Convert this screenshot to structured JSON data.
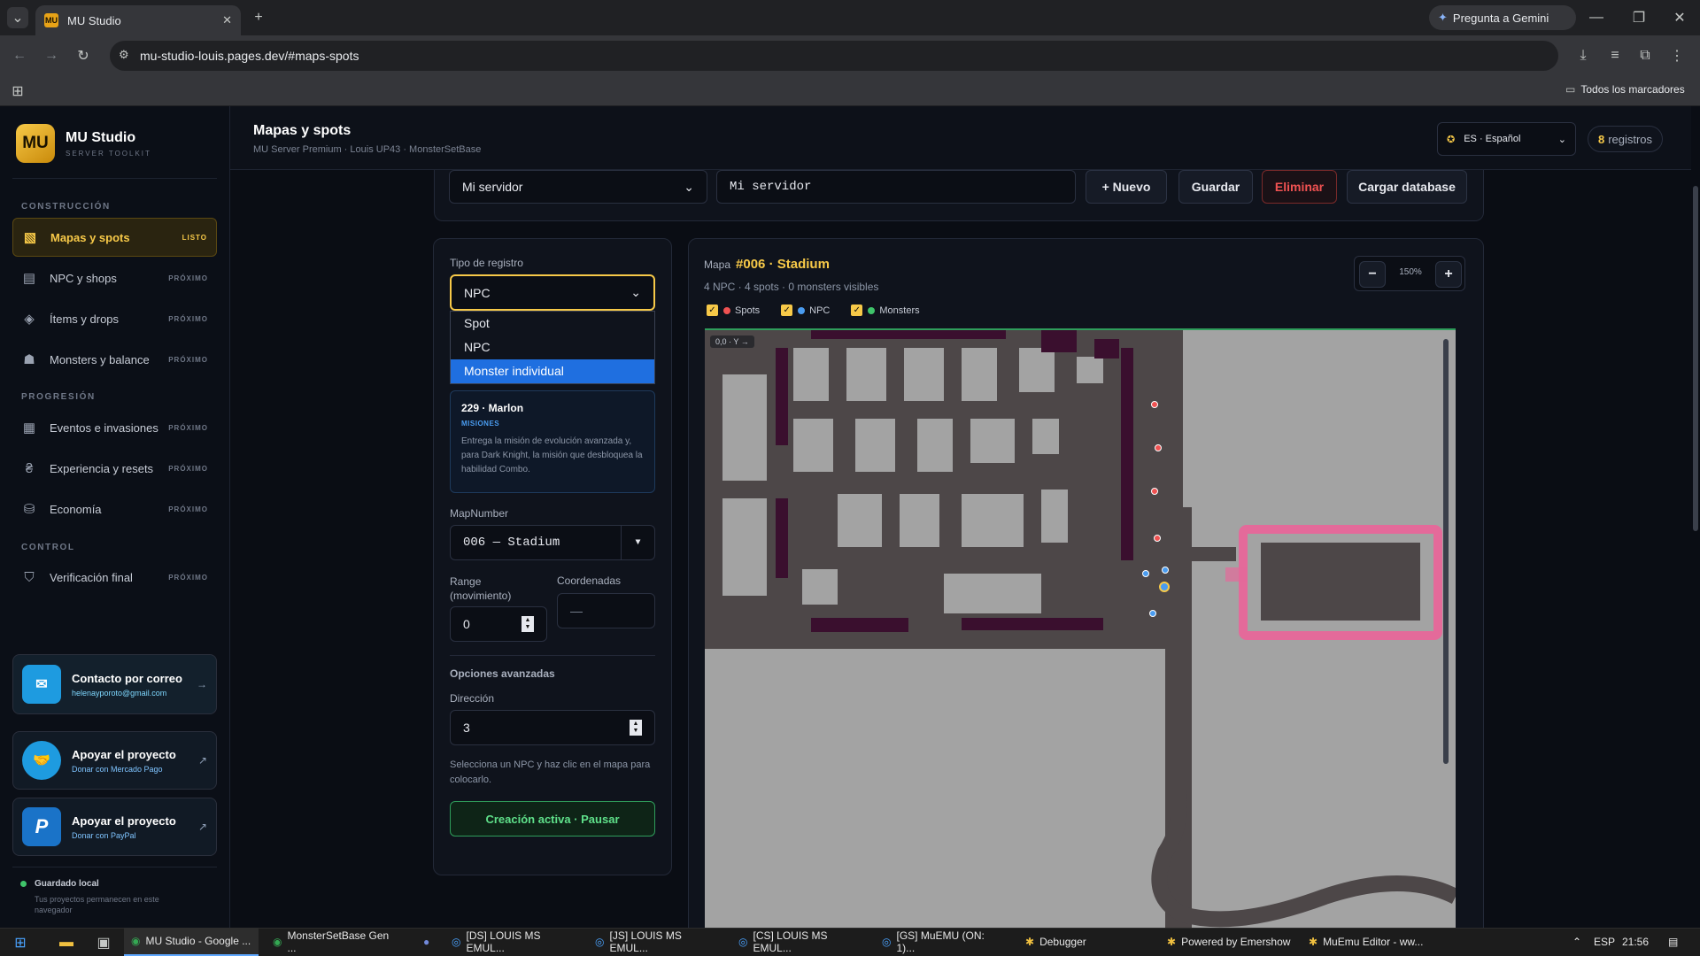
{
  "browser": {
    "tab_title": "MU Studio",
    "tab_favicon": "MU",
    "gemini_label": "Pregunta a Gemini",
    "url": "mu-studio-louis.pages.dev/#maps-spots",
    "bookmarks_label": "Todos los marcadores"
  },
  "sidebar": {
    "logo_mark": "MU",
    "app_name": "MU Studio",
    "app_tagline": "SERVER TOOLKIT",
    "sections": [
      {
        "title": "CONSTRUCCIÓN"
      },
      {
        "title": "PROGRESIÓN"
      },
      {
        "title": "CONTROL"
      }
    ],
    "items": [
      {
        "label": "Mapas y spots",
        "badge": "LISTO",
        "icon": "map-icon"
      },
      {
        "label": "NPC y shops",
        "badge": "PRÓXIMO",
        "icon": "shop-icon"
      },
      {
        "label": "Ítems y drops",
        "badge": "PRÓXIMO",
        "icon": "layers-icon"
      },
      {
        "label": "Monsters y balance",
        "badge": "PRÓXIMO",
        "icon": "monster-icon"
      },
      {
        "label": "Eventos e invasiones",
        "badge": "PRÓXIMO",
        "icon": "calendar-icon"
      },
      {
        "label": "Experiencia y resets",
        "badge": "PRÓXIMO",
        "icon": "currency-icon"
      },
      {
        "label": "Economía",
        "badge": "PRÓXIMO",
        "icon": "database-icon"
      },
      {
        "label": "Verificación final",
        "badge": "PRÓXIMO",
        "icon": "shield-check-icon"
      }
    ],
    "contact": {
      "title": "Contacto por correo",
      "email": "helenayporoto@gmail.com"
    },
    "support_mp": {
      "title": "Apoyar el proyecto",
      "subtitle": "Donar con Mercado Pago"
    },
    "support_pp": {
      "title": "Apoyar el proyecto",
      "subtitle": "Donar con PayPal"
    },
    "saved": {
      "title": "Guardado local",
      "subtitle": "Tus proyectos permanecen en este navegador"
    }
  },
  "header": {
    "title": "Mapas y spots",
    "subtitle": "MU Server Premium · Louis UP43 · MonsterSetBase",
    "language": "ES · Español",
    "records_count": "8",
    "records_label": "registros"
  },
  "server_bar": {
    "select_value": "Mi servidor",
    "name_value": "Mi servidor",
    "new_label": "+ Nuevo",
    "save_label": "Guardar",
    "delete_label": "Eliminar",
    "load_label": "Cargar database"
  },
  "form": {
    "type_label": "Tipo de registro",
    "type_value": "NPC",
    "type_options": [
      "Spot",
      "NPC",
      "Monster individual"
    ],
    "type_highlighted": "Monster individual",
    "npc_card": {
      "title": "229 · Marlon",
      "tag": "MISIONES",
      "description": "Entrega la misión de evolución avanzada y, para Dark Knight, la misión que desbloquea la habilidad Combo."
    },
    "map_label": "MapNumber",
    "map_value": "006 — Stadium",
    "range_label": "Range (movimiento)",
    "range_value": "0",
    "coords_label": "Coordenadas",
    "coords_value": "—",
    "advanced_label": "Opciones avanzadas",
    "direction_label": "Dirección",
    "direction_value": "3",
    "hint": "Selecciona un NPC y haz clic en el mapa para colocarlo.",
    "action_label": "Creación activa · Pausar"
  },
  "map_panel": {
    "prefix": "Mapa",
    "map_title": "#006 · Stadium",
    "stats": "4 NPC · 4 spots · 0 monsters visibles",
    "zoom": "150%",
    "zoom_out": "−",
    "zoom_in": "+",
    "filters": [
      {
        "label": "Spots",
        "color": "#f05252",
        "checked": true
      },
      {
        "label": "NPC",
        "color": "#4a9cf0",
        "checked": true
      },
      {
        "label": "Monsters",
        "color": "#3fc46a",
        "checked": true
      }
    ],
    "coord_chip": "0,0 · Y →"
  },
  "taskbar": {
    "items": [
      "MU Studio - Google ...",
      "MonsterSetBase Gen ...",
      "[DS] LOUIS MS EMUL...",
      "[JS] LOUIS MS EMUL...",
      "[CS] LOUIS MS EMUL...",
      "[GS] MuEMU (ON: 1)...",
      "Debugger",
      "Powered by Emershow",
      "MuEmu Editor - ww..."
    ],
    "lang": "ESP",
    "time": "21:56"
  },
  "colors": {
    "accent": "#f7c948",
    "danger": "#f05252",
    "success": "#3fc46a",
    "info": "#4a9cf0"
  }
}
